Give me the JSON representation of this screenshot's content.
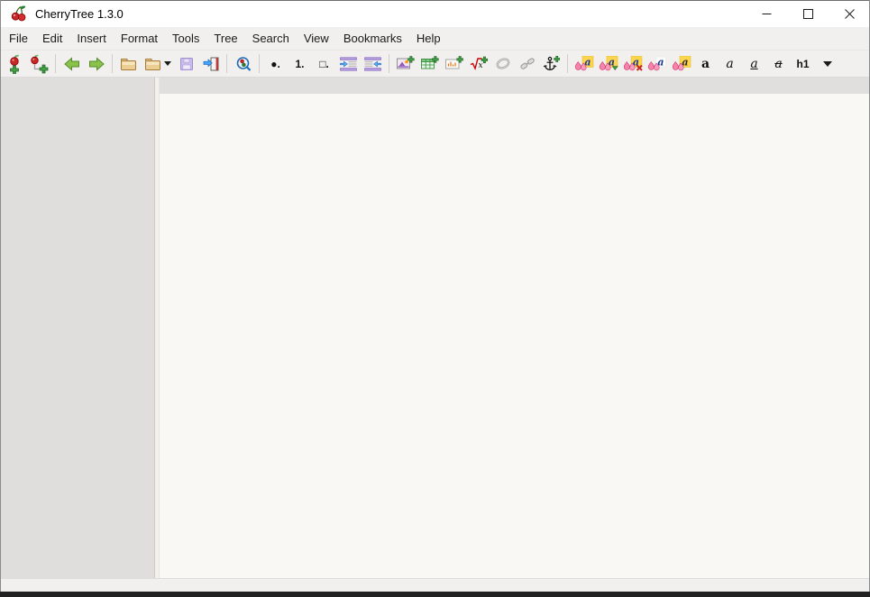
{
  "window": {
    "title": "CherryTree 1.3.0",
    "app_icon": "cherries-logo-icon",
    "controls": [
      "minimize",
      "maximize",
      "close"
    ]
  },
  "menubar": {
    "items": [
      "File",
      "Edit",
      "Insert",
      "Format",
      "Tools",
      "Tree",
      "Search",
      "View",
      "Bookmarks",
      "Help"
    ]
  },
  "toolbar": {
    "bullet_label": "●.",
    "numbered_label": "1.",
    "todo_label": "□.",
    "bold_label": "a",
    "italic_label": "a",
    "underline_label": "a",
    "strikethrough_label": "a",
    "heading_label": "h1",
    "icons": [
      "new-node",
      "new-subnode",
      "go-back",
      "go-forward",
      "open-file",
      "open-recent",
      "save",
      "save-as",
      "find-in-nodes",
      "bullet-list",
      "numbered-list",
      "todo-list",
      "indent-right",
      "indent-left",
      "insert-image",
      "insert-table",
      "insert-codebox",
      "insert-latex",
      "insert-link",
      "edit-link",
      "insert-anchor",
      "format-latest",
      "format-apply",
      "format-remove",
      "foreground-color",
      "background-color",
      "bold",
      "italic",
      "underline",
      "strikethrough",
      "heading-h1",
      "heading-menu"
    ]
  },
  "statusbar": {
    "text": ""
  },
  "colors": {
    "titlebar_bg": "#ffffff",
    "bar_bg": "#f1f0ee",
    "tree_panel_bg": "#dfdedc",
    "editor_bg": "#f9f8f5",
    "editor_header_bg": "#e0dfdd",
    "cherry_red": "#c62828",
    "cherry_pink": "#f584ad",
    "accent_green": "#43a047",
    "arrow_green": "#8bc34a",
    "folder_tan": "#ecce93",
    "save_purple": "#cabdea",
    "indent_purple": "#b39ddb",
    "arrow_blue": "#64b5f6",
    "highlight_yellow": "#ffd54f",
    "latex_red": "#cc0000",
    "disabled_gray": "#a8a8a8",
    "window_border_dark": "#212121"
  }
}
